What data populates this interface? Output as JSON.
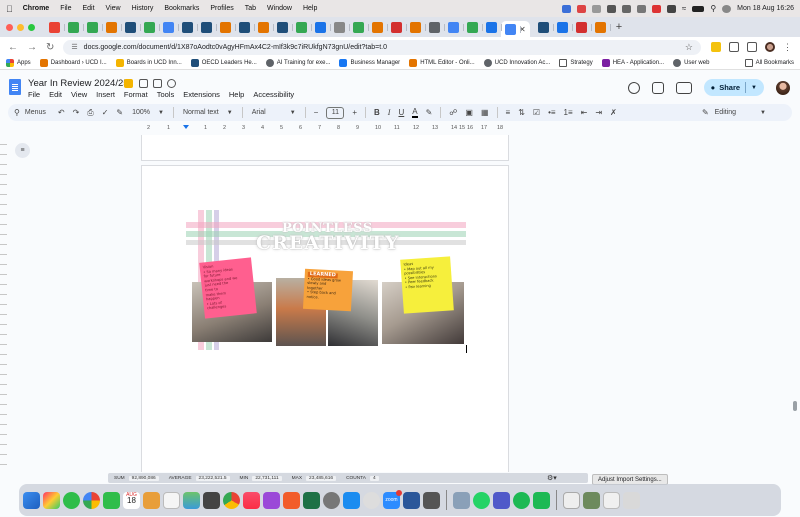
{
  "menubar": {
    "app": "Chrome",
    "items": [
      "File",
      "Edit",
      "View",
      "History",
      "Bookmarks",
      "Profiles",
      "Tab",
      "Window",
      "Help"
    ],
    "clock": "Mon 18 Aug  16:26"
  },
  "browser": {
    "url": "docs.google.com/document/d/1X87oAodtc0vAgyHFmAx4C2-mIf3k9c7iRUkfgN73gnU/edit?tab=t.0"
  },
  "bookmarks": {
    "items": [
      "Apps",
      "Dashboard › UCD I...",
      "Boards in UCD Inn...",
      "OECD Leaders He...",
      "AI Training for exe...",
      "Business Manager",
      "HTML Editor - Onli...",
      "UCD Innovation Ac...",
      "Strategy",
      "HEA - Application...",
      "User web"
    ],
    "all": "All Bookmarks"
  },
  "doc": {
    "title": "Year In Review 2024/25",
    "menu": [
      "File",
      "Edit",
      "View",
      "Insert",
      "Format",
      "Tools",
      "Extensions",
      "Help",
      "Accessibility"
    ],
    "share": "Share"
  },
  "toolbar": {
    "search": "Menus",
    "zoom": "100%",
    "style": "Normal text",
    "font": "Arial",
    "font_size": "11",
    "mode": "Editing"
  },
  "ruler": [
    "2",
    "1",
    "1",
    "2",
    "3",
    "4",
    "5",
    "6",
    "7",
    "8",
    "9",
    "10",
    "11",
    "12",
    "13",
    "14",
    "15",
    "16",
    "17",
    "18"
  ],
  "image": {
    "title_top": "POINTLESS",
    "title_main": "CREATIVITY",
    "note_pink": [
      "Vision",
      "• So many ideas",
      "  for future",
      "  workshops and we",
      "  just need the",
      "  time to",
      "  make them",
      "  happen",
      "• Lots of",
      "  challenges"
    ],
    "note_orange_title": "LEARNED",
    "note_orange": [
      "• Good ideas grow",
      "  slowly and",
      "  together",
      "• Step back and",
      "  notice."
    ],
    "note_yellow": [
      "Ideas",
      "• Map out all my",
      "  possibilities",
      "• See interactions",
      "• Peer feedback",
      "• Pair learning"
    ]
  },
  "sheet_status": {
    "sum_label": "SUM",
    "sum": "92,890,086",
    "avg_label": "AVERAGE",
    "avg": "23,222,521.5",
    "min_label": "MIN",
    "min": "22,731,111",
    "max_label": "MAX",
    "max": "23,485,616",
    "count_label": "COUNTA",
    "count": "4",
    "tip": "Adjust Import Settings..."
  },
  "dock": {
    "calendar_month": "AUG",
    "calendar_day": "18",
    "zoom_label": "zoom"
  },
  "colors": {
    "accent": "#1a73e8",
    "share_bg": "#c2e7ff",
    "note_pink": "#ff5f8f",
    "note_orange": "#f7a23b",
    "note_yellow": "#f6ef3c"
  }
}
